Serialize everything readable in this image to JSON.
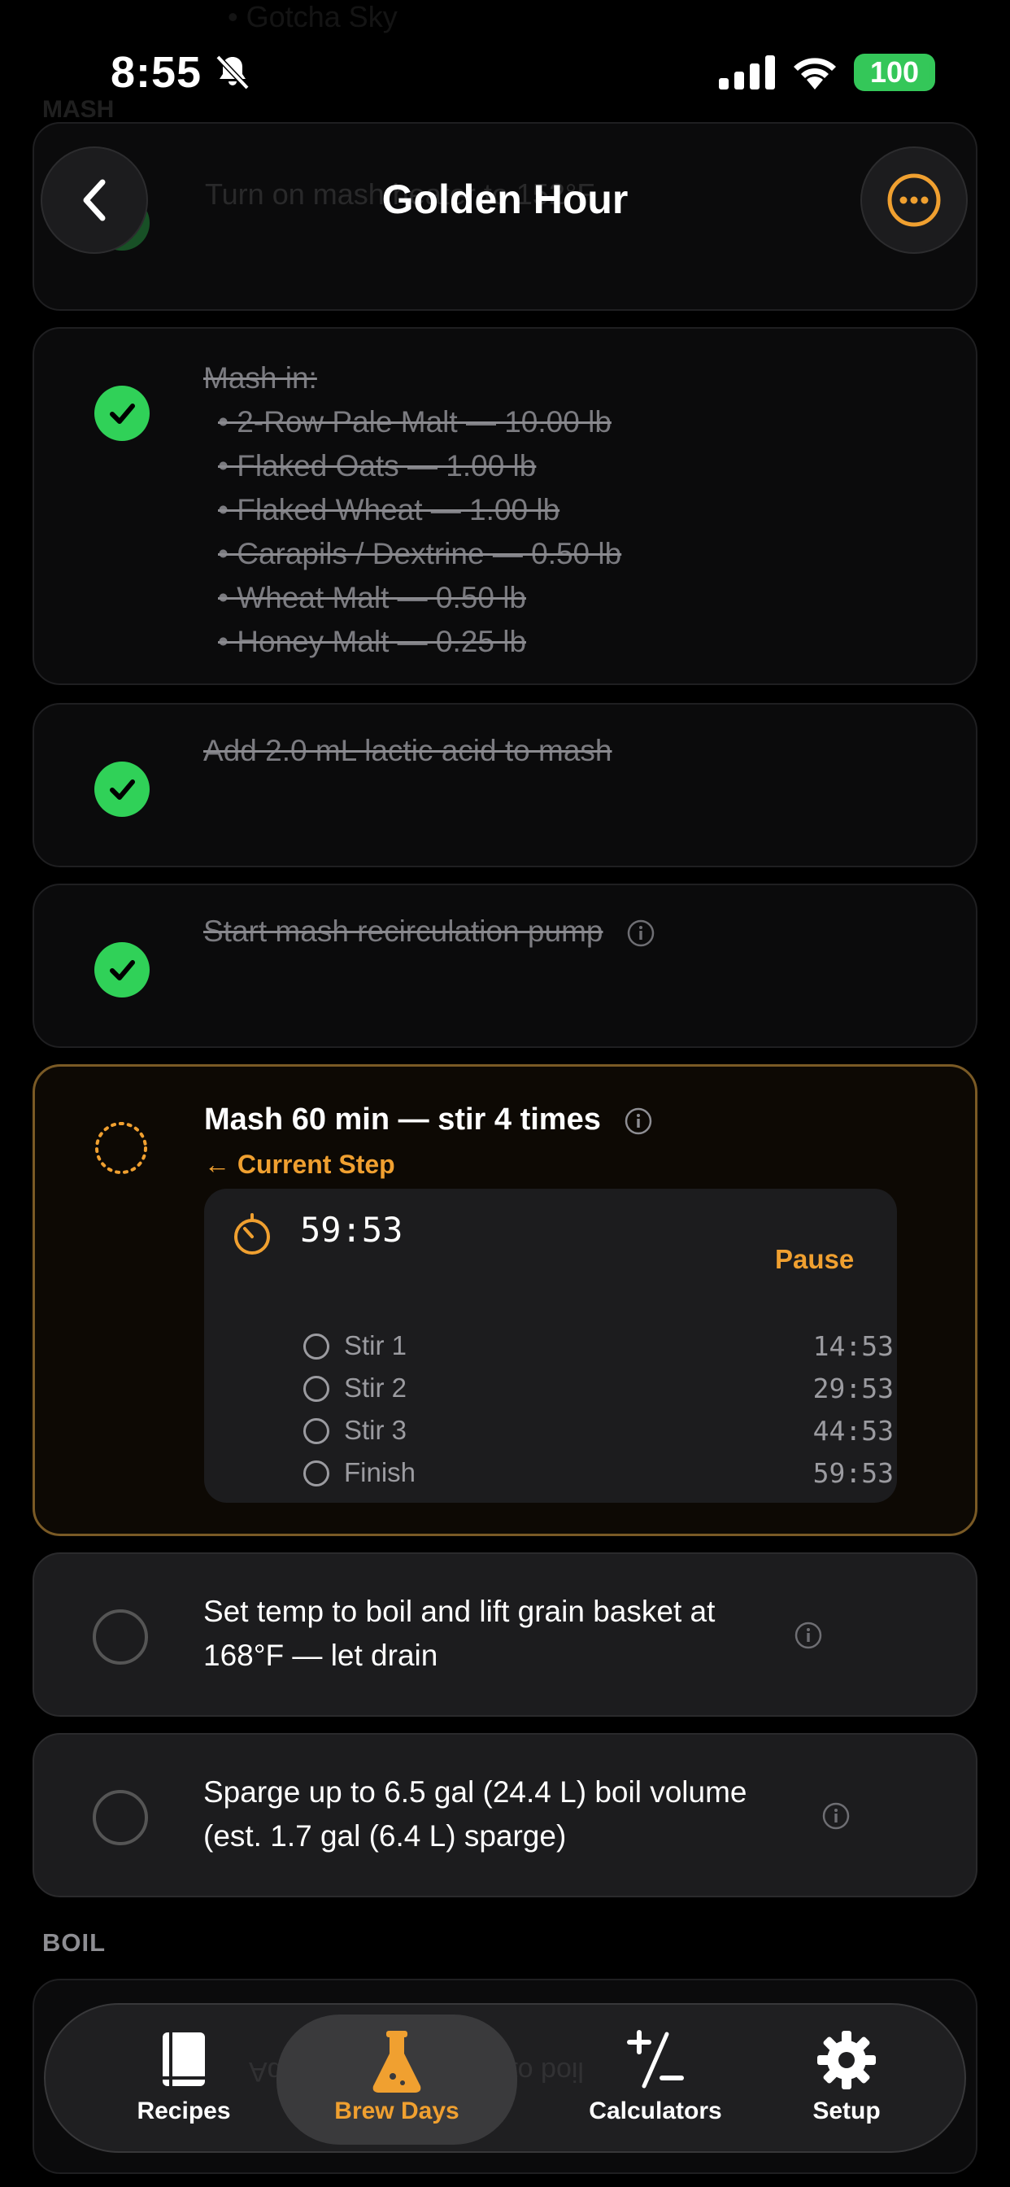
{
  "status_bar": {
    "time": "8:55",
    "battery": "100"
  },
  "header": {
    "title": "Golden Hour"
  },
  "ghost": {
    "top_line": "• Gotcha Sky",
    "section": "MASH",
    "previous_step": "Turn on mash heater to 152°F"
  },
  "steps": [
    {
      "title": "Mash in:",
      "lines": [
        "• 2-Row Pale Malt — 10.00 lb",
        "• Flaked Oats — 1.00 lb",
        "• Flaked Wheat — 1.00 lb",
        "• Carapils / Dextrine — 0.50 lb",
        "• Wheat Malt — 0.50 lb",
        "• Honey Malt — 0.25 lb"
      ]
    },
    {
      "text": "Add 2.0 mL lactic acid to mash"
    },
    {
      "text": "Start mash recirculation pump"
    },
    {
      "text": "Mash 60 min — stir 4 times",
      "current_marker": "← Current Step",
      "timer": "59:53",
      "pause_label": "Pause",
      "milestones": [
        {
          "label": "Stir 1",
          "time": "14:53"
        },
        {
          "label": "Stir 2",
          "time": "29:53"
        },
        {
          "label": "Stir 3",
          "time": "44:53"
        },
        {
          "label": "Finish",
          "time": "59:53"
        }
      ]
    },
    {
      "line1": "Set temp to boil and lift grain basket at",
      "line2": "168°F — let drain"
    },
    {
      "line1": "Sparge up to 6.5 gal (24.4 L) boil volume",
      "line2": "(est. 1.7 gal (6.4 L) sparge)"
    }
  ],
  "section_boil": "BOIL",
  "tab_bar": {
    "ghost_text": "Add 1.0 tsp Whirlfloc to boil",
    "tabs": [
      {
        "label": "Recipes",
        "icon": "book-icon"
      },
      {
        "label": "Brew Days",
        "icon": "flask-icon",
        "active": true
      },
      {
        "label": "Calculators",
        "icon": "plus-minus-icon"
      },
      {
        "label": "Setup",
        "icon": "gear-icon"
      }
    ]
  },
  "colors": {
    "accent": "#f0a030",
    "done": "#30d158",
    "background": "#000000"
  }
}
